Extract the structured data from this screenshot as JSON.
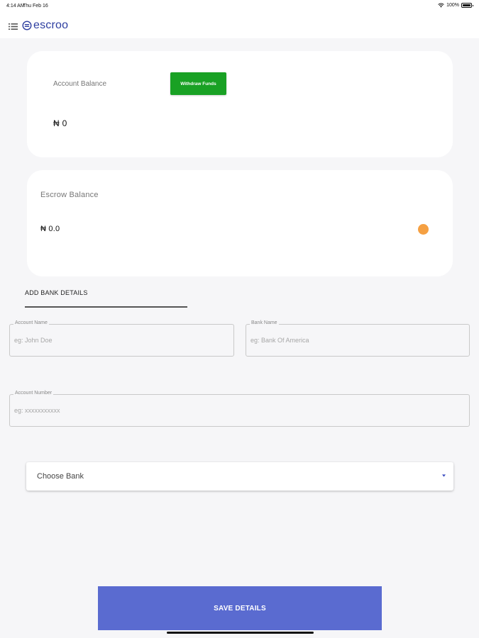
{
  "status_bar": {
    "time": "4:14 AM",
    "date": "Thu Feb 16",
    "battery": "100%"
  },
  "header": {
    "logo_text": "escroo",
    "brand_color": "#2d3ea0",
    "menu_icon": "list-icon"
  },
  "account_card": {
    "label": "Account Balance",
    "withdraw_label": "Withdraw Funds",
    "value": "₦ 0",
    "button_color": "#19a124"
  },
  "escrow_card": {
    "label": "Escrow Balance",
    "value": "₦ 0.0",
    "dot_color": "#f5a042"
  },
  "bank_details": {
    "title": "ADD BANK DETAILS",
    "account_name": {
      "label": "Account Name",
      "placeholder": "eg: John Doe",
      "value": ""
    },
    "bank_name": {
      "label": "Bank Name",
      "placeholder": "eg: Bank Of America",
      "value": ""
    },
    "account_number": {
      "label": "Account Number",
      "placeholder": "eg: xxxxxxxxxxx",
      "value": ""
    },
    "choose_bank": {
      "selected": "Choose Bank"
    }
  },
  "actions": {
    "save_label": "SAVE DETAILS",
    "save_color": "#5a6bd0"
  }
}
